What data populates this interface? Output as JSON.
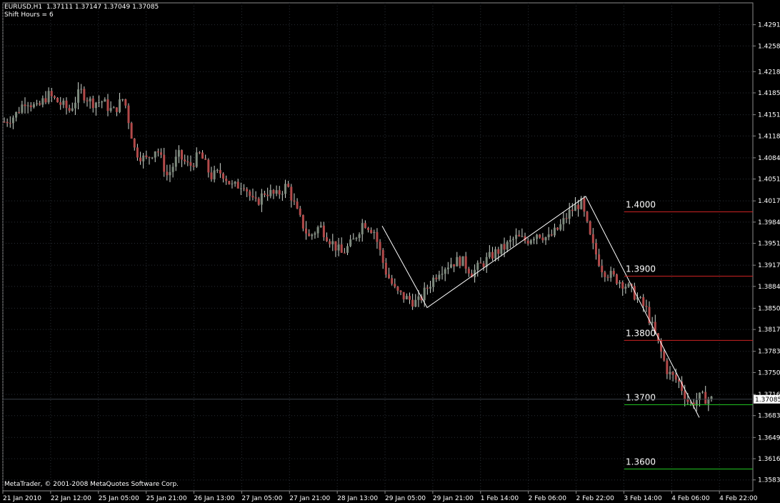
{
  "header": {
    "line1": "EURUSD,H1  1.37111 1.37147 1.37049 1.37085",
    "line2": "Shift Hours = 6"
  },
  "copyright": "MetaTrader, © 2001-2008 MetaQuotes Software Corp.",
  "colors": {
    "background": "#000000",
    "grid": "#2a2f36",
    "bull_candle": "#7d8a7d",
    "bear_candle": "#b34a4a",
    "wick": "#cfd6cf",
    "zigzag": "#ffffff",
    "resistance_line": "#cc2222",
    "support_line": "#22cc22"
  },
  "chart_data": {
    "type": "candlestick",
    "symbol": "EURUSD",
    "timeframe": "H1",
    "ylim": [
      1.3566,
      1.4325
    ],
    "y_ticks": [
      "1.42910",
      "1.42580",
      "1.42180",
      "1.41850",
      "1.41510",
      "1.41180",
      "1.40840",
      "1.40510",
      "1.40170",
      "1.39840",
      "1.39510",
      "1.39170",
      "1.38840",
      "1.38500",
      "1.38170",
      "1.37830",
      "1.37500",
      "1.37160",
      "1.36830",
      "1.36490",
      "1.36160",
      "1.35830"
    ],
    "x_ticks": [
      "21 Jan 2010",
      "22 Jan 12:00",
      "25 Jan 05:00",
      "25 Jan 21:00",
      "26 Jan 13:00",
      "27 Jan 05:00",
      "27 Jan 21:00",
      "28 Jan 13:00",
      "29 Jan 05:00",
      "29 Jan 21:00",
      "1 Feb 14:00",
      "2 Feb 06:00",
      "2 Feb 22:00",
      "3 Feb 14:00",
      "4 Feb 06:00",
      "4 Feb 22:00"
    ],
    "current_price": "1.37085",
    "path": [
      1.414,
      1.415,
      1.4175,
      1.416,
      1.4182,
      1.417,
      1.4158,
      1.4188,
      1.417,
      1.4172,
      1.4155,
      1.4178,
      1.4095,
      1.408,
      1.41,
      1.4055,
      1.4088,
      1.407,
      1.409,
      1.4055,
      1.4062,
      1.4038,
      1.4045,
      1.401,
      1.4032,
      1.4025,
      1.4042,
      1.3995,
      1.396,
      1.3978,
      1.3955,
      1.3935,
      1.3952,
      1.3985,
      1.397,
      1.391,
      1.3875,
      1.3865,
      1.3858,
      1.3885,
      1.391,
      1.392,
      1.3925,
      1.3905,
      1.392,
      1.3935,
      1.3945,
      1.396,
      1.3955,
      1.3968,
      1.3958,
      1.3975,
      1.4,
      1.4015,
      1.395,
      1.391,
      1.3898,
      1.3888,
      1.387,
      1.3848,
      1.38,
      1.375,
      1.3735,
      1.37,
      1.3712,
      1.3708
    ],
    "zigzag_points": [
      [
        1.3978,
        "29 Jan 05:00"
      ],
      [
        1.3851,
        "29 Jan 21:00"
      ],
      [
        1.4024,
        "2 Feb 22:00"
      ],
      [
        1.368,
        "4 Feb 22:00"
      ]
    ],
    "levels": [
      {
        "price": 1.4,
        "label": "1.4000",
        "kind": "resistance"
      },
      {
        "price": 1.39,
        "label": "1.3900",
        "kind": "resistance"
      },
      {
        "price": 1.38,
        "label": "1.3800",
        "kind": "resistance"
      },
      {
        "price": 1.37,
        "label": "1.3700",
        "kind": "support"
      },
      {
        "price": 1.36,
        "label": "1.3600",
        "kind": "support"
      }
    ]
  }
}
